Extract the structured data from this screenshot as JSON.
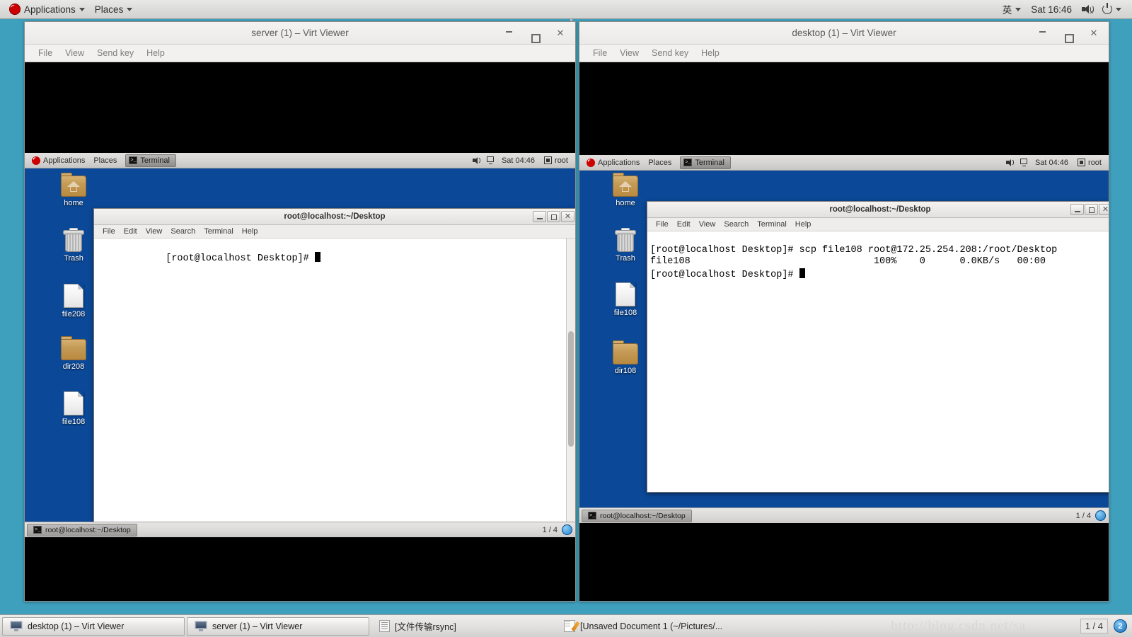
{
  "host_panel": {
    "applications": "Applications",
    "places": "Places",
    "input_method": "英",
    "clock": "Sat 16:46",
    "icons": {
      "redhat": "redhat-logo-icon",
      "speaker": "volume-muted-icon",
      "power": "power-icon"
    }
  },
  "windows": [
    {
      "id": "server",
      "title": "server (1) – Virt Viewer",
      "menu": [
        "File",
        "View",
        "Send key",
        "Help"
      ],
      "buttons": {
        "minimize": "_",
        "maximize": "□",
        "close": "✕"
      },
      "guest": {
        "panel": {
          "applications": "Applications",
          "places": "Places",
          "task": "Terminal",
          "clock": "Sat 04:46",
          "user": "root"
        },
        "desktop_icons": [
          {
            "name": "home",
            "type": "home-folder"
          },
          {
            "name": "Trash",
            "type": "trash"
          },
          {
            "name": "file208",
            "type": "file"
          },
          {
            "name": "dir208",
            "type": "folder"
          },
          {
            "name": "file108",
            "type": "file"
          }
        ],
        "terminal": {
          "title": "root@localhost:~/Desktop",
          "menu": [
            "File",
            "Edit",
            "View",
            "Search",
            "Terminal",
            "Help"
          ],
          "lines": [
            "[root@localhost Desktop]# "
          ]
        },
        "bottom": {
          "window_button": "root@localhost:~/Desktop",
          "pager": "1 / 4"
        }
      }
    },
    {
      "id": "desktop",
      "title": "desktop (1) – Virt Viewer",
      "menu": [
        "File",
        "View",
        "Send key",
        "Help"
      ],
      "buttons": {
        "minimize": "_",
        "maximize": "□",
        "close": "✕"
      },
      "guest": {
        "panel": {
          "applications": "Applications",
          "places": "Places",
          "task": "Terminal",
          "clock": "Sat 04:46",
          "user": "root"
        },
        "desktop_icons": [
          {
            "name": "home",
            "type": "home-folder"
          },
          {
            "name": "Trash",
            "type": "trash"
          },
          {
            "name": "file108",
            "type": "file"
          },
          {
            "name": "dir108",
            "type": "folder"
          }
        ],
        "terminal": {
          "title": "root@localhost:~/Desktop",
          "menu": [
            "File",
            "Edit",
            "View",
            "Search",
            "Terminal",
            "Help"
          ],
          "lines": [
            "[root@localhost Desktop]# scp file108 root@172.25.254.208:/root/Desktop",
            "file108                                100%    0      0.0KB/s   00:00",
            "[root@localhost Desktop]# "
          ]
        },
        "bottom": {
          "window_button": "root@localhost:~/Desktop",
          "pager": "1 / 4"
        }
      }
    }
  ],
  "taskbar": {
    "items": [
      {
        "label": "desktop (1) – Virt Viewer",
        "icon": "monitor-icon"
      },
      {
        "label": "server (1) – Virt Viewer",
        "icon": "monitor-icon"
      },
      {
        "label": "[文件传输rsync]",
        "icon": "document-icon"
      },
      {
        "label": "[Unsaved Document 1 (~/Pictures/...",
        "icon": "notepad-icon"
      }
    ],
    "watermark": "http://blog.csdn.net/sa",
    "pager": "1 / 4",
    "workspace": "2"
  }
}
